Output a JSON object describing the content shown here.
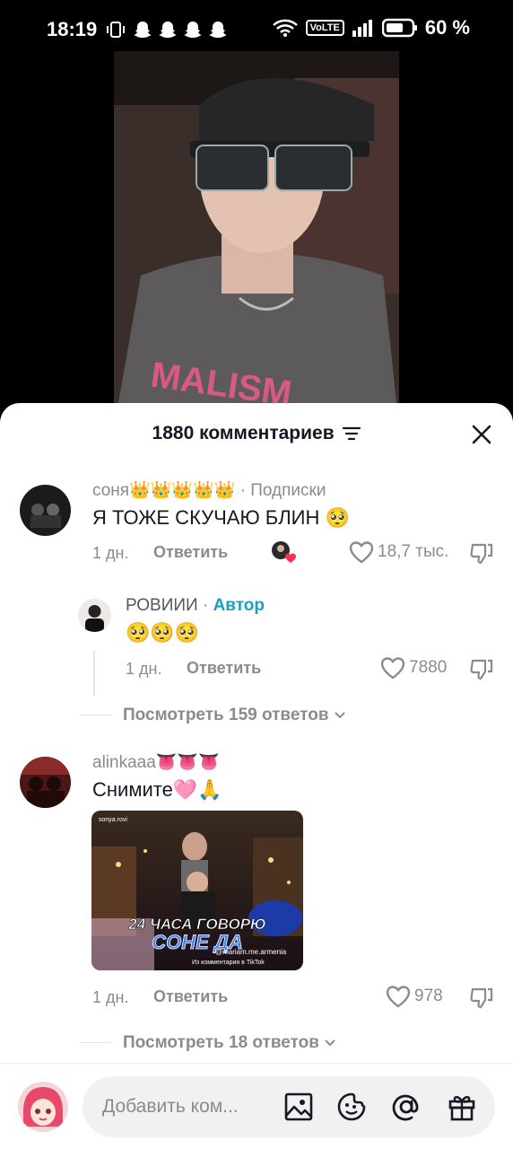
{
  "status_bar": {
    "time": "18:19",
    "network": "VoLTE",
    "battery": "60 %"
  },
  "comments": {
    "title": "1880 комментариев",
    "items": [
      {
        "username": "соня👑👑👑👑👑",
        "tag": "Подписки",
        "text": "Я ТОЖЕ СКУЧАЮ БЛИН 🥺",
        "time": "1 дн.",
        "reply": "Ответить",
        "likes": "18,7 тыс."
      },
      {
        "username": "РОВИИИ",
        "tag": "Автор",
        "text": "🥺🥺🥺",
        "time": "1 дн.",
        "reply": "Ответить",
        "likes": "7880"
      },
      {
        "username": "alinkaaa👅👅👅",
        "text": "Снимите🩷🙏",
        "time": "1 дн.",
        "reply": "Ответить",
        "likes": "978",
        "gif": {
          "account": "sonya.rovi",
          "line1": "24 ЧАСА ГОВОРЮ",
          "line2": "СОНЕ ДА",
          "handle": "@mariam.me.armenia",
          "caption": "Из комментария в TikTok"
        }
      }
    ],
    "view_replies_1": "Посмотреть 159 ответов",
    "view_replies_2": "Посмотреть 18 ответов"
  },
  "input": {
    "placeholder": "Добавить ком..."
  },
  "colors": {
    "author_accent": "#1a9fc0",
    "like_heart": "#fe2c55"
  }
}
